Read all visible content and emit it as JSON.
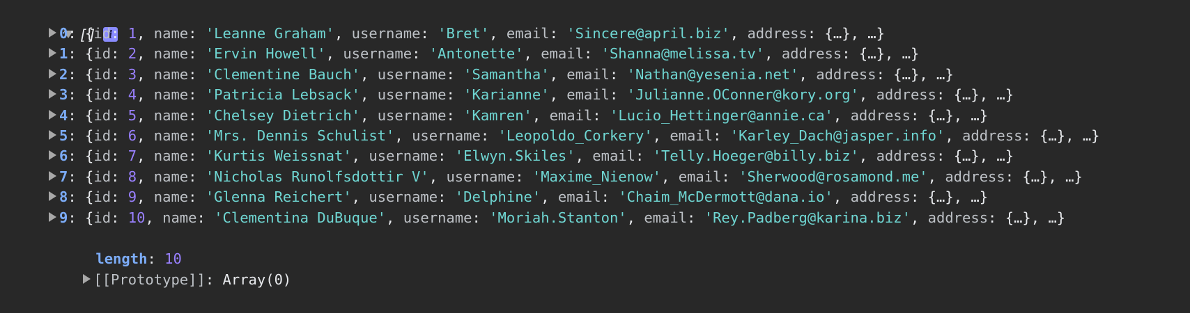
{
  "header": {
    "array_label": "[]",
    "info_glyph": "i"
  },
  "rows": [
    {
      "index": "0",
      "id": "1",
      "name": "'Leanne Graham'",
      "username": "'Bret'",
      "email": "'Sincere@april.biz'"
    },
    {
      "index": "1",
      "id": "2",
      "name": "'Ervin Howell'",
      "username": "'Antonette'",
      "email": "'Shanna@melissa.tv'"
    },
    {
      "index": "2",
      "id": "3",
      "name": "'Clementine Bauch'",
      "username": "'Samantha'",
      "email": "'Nathan@yesenia.net'"
    },
    {
      "index": "3",
      "id": "4",
      "name": "'Patricia Lebsack'",
      "username": "'Karianne'",
      "email": "'Julianne.OConner@kory.org'"
    },
    {
      "index": "4",
      "id": "5",
      "name": "'Chelsey Dietrich'",
      "username": "'Kamren'",
      "email": "'Lucio_Hettinger@annie.ca'"
    },
    {
      "index": "5",
      "id": "6",
      "name": "'Mrs. Dennis Schulist'",
      "username": "'Leopoldo_Corkery'",
      "email": "'Karley_Dach@jasper.info'"
    },
    {
      "index": "6",
      "id": "7",
      "name": "'Kurtis Weissnat'",
      "username": "'Elwyn.Skiles'",
      "email": "'Telly.Hoeger@billy.biz'"
    },
    {
      "index": "7",
      "id": "8",
      "name": "'Nicholas Runolfsdottir V'",
      "username": "'Maxime_Nienow'",
      "email": "'Sherwood@rosamond.me'"
    },
    {
      "index": "8",
      "id": "9",
      "name": "'Glenna Reichert'",
      "username": "'Delphine'",
      "email": "'Chaim_McDermott@dana.io'"
    },
    {
      "index": "9",
      "id": "10",
      "name": "'Clementina DuBuque'",
      "username": "'Moriah.Stanton'",
      "email": "'Rey.Padberg@karina.biz'"
    }
  ],
  "keys": {
    "id": "id",
    "name": "name",
    "username": "username",
    "email": "email",
    "address": "address",
    "collapsed_object": "{…}",
    "more": "…"
  },
  "length": {
    "label": "length",
    "value": "10"
  },
  "prototype": {
    "label": "[[Prototype]]",
    "value": "Array(0)"
  }
}
